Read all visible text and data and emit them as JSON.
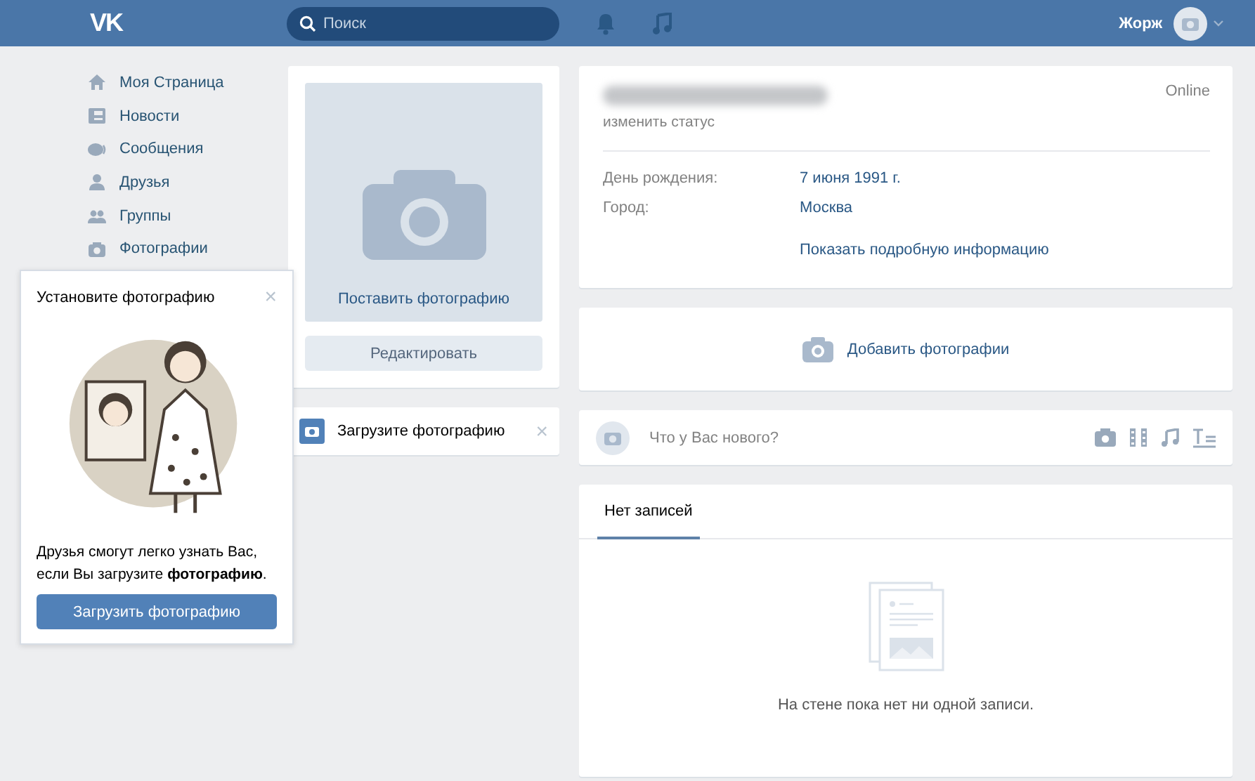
{
  "header": {
    "logo": "VK",
    "search": {
      "placeholder": "Поиск"
    },
    "user_name": "Жорж"
  },
  "sidebar": {
    "items": [
      {
        "label": "Моя Страница"
      },
      {
        "label": "Новости"
      },
      {
        "label": "Сообщения"
      },
      {
        "label": "Друзья"
      },
      {
        "label": "Группы"
      },
      {
        "label": "Фотографии"
      }
    ]
  },
  "photo_card": {
    "set_photo": "Поставить фотографию",
    "edit_button": "Редактировать"
  },
  "upload_hint": {
    "label": "Загрузите фотографию",
    "close": "×"
  },
  "popup": {
    "title": "Установите фотографию",
    "close": "×",
    "text": "Друзья смогут легко узнать Вас, если Вы загрузите **фотографию**.",
    "button": "Загрузить фотографию"
  },
  "profile": {
    "status_link": "изменить статус",
    "online": "Online",
    "fields": [
      {
        "label": "День рождения:",
        "value": "7 июня 1991 г."
      },
      {
        "label": "Город:",
        "value": "Москва"
      }
    ],
    "more_link": "Показать подробную информацию"
  },
  "add_photos": "Добавить фотографии",
  "post_box": {
    "placeholder": "Что у Вас нового?"
  },
  "wall": {
    "tabs": [
      {
        "label": "Нет записей",
        "selected": true
      }
    ],
    "empty_text": "На стене пока нет ни одной записи."
  }
}
